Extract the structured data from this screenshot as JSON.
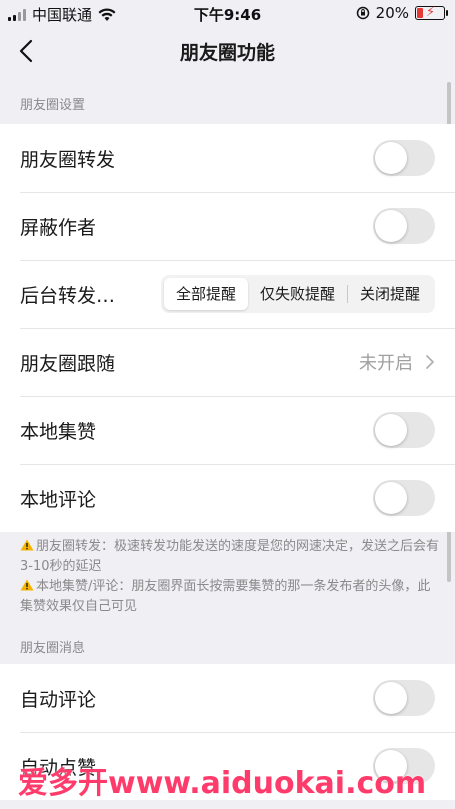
{
  "status_bar": {
    "carrier": "中国联通",
    "time": "下午9:46",
    "battery_percent": "20%",
    "battery_level": 0.2
  },
  "nav": {
    "title": "朋友圈功能"
  },
  "sections": {
    "settings_header": "朋友圈设置",
    "messages_header": "朋友圈消息"
  },
  "settings": {
    "forward": {
      "label": "朋友圈转发",
      "on": false
    },
    "block_author": {
      "label": "屏蔽作者",
      "on": false
    },
    "background_forward": {
      "label": "后台转发…",
      "options": [
        "全部提醒",
        "仅失败提醒",
        "关闭提醒"
      ],
      "selected": "全部提醒"
    },
    "follow": {
      "label": "朋友圈跟随",
      "value": "未开启"
    },
    "local_like": {
      "label": "本地集赞",
      "on": false
    },
    "local_comment": {
      "label": "本地评论",
      "on": false
    }
  },
  "notes": {
    "line1": "朋友圈转发：极速转发功能发送的速度是您的网速决定，发送之后会有3-10秒的延迟",
    "line2": "本地集赞/评论：朋友圈界面长按需要集赞的那一条发布者的头像，此集赞效果仅自己可见"
  },
  "messages": {
    "auto_comment": {
      "label": "自动评论",
      "on": false
    },
    "auto_like": {
      "label": "自动点赞",
      "on": false
    }
  },
  "watermark": "爱多开www.aiduokai.com",
  "colors": {
    "background": "#efeff4",
    "toggle_off": "#e6e6e6",
    "warning": "#f5b301",
    "watermark": "#ff3b6b"
  }
}
